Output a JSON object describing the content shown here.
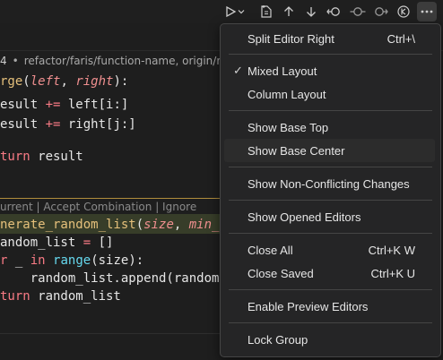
{
  "toolbar": {
    "icons": [
      "run-icon",
      "chevron-down-icon",
      "new-file-icon",
      "arrow-up-icon",
      "arrow-down-icon",
      "accept-current-icon",
      "accept-both-icon",
      "accept-incoming-icon",
      "toggle-icon",
      "more-icon"
    ]
  },
  "breadcrumb": {
    "num": "4",
    "dot": "•",
    "text": "refactor/faris/function-name, origin/refactor"
  },
  "code": {
    "l1_fn": "rge",
    "l1_open": "(",
    "l1_p1": "left",
    "l1_comma": ", ",
    "l2_var": "esult",
    "l2_op": " += ",
    "l2_rest": "left[i:]",
    "l3_var": "esult",
    "l3_op": " += ",
    "l3_rest": "right[j:]",
    "l4_kw": "turn",
    "l4_rest": " result",
    "conflict_actions": "urrent | Accept Combination | Ignore",
    "l5_fn": "nerate_random_list",
    "l5_open": "(",
    "l5_p1": "size",
    "l5_comma": ", ",
    "l5_p2": "min_",
    "l6_var": "andom_list",
    "l6_op": " = ",
    "l6_rest": "[]",
    "l7_kw": "r",
    "l7_mid": " _ ",
    "l7_in": "in",
    "l7_sp": " ",
    "l7_builtin": "range",
    "l7_rest": "(size):",
    "l8_text": "    random_list.append(random.r",
    "l9_kw": "turn",
    "l9_rest": " random_list"
  },
  "code_l1_p2": "right",
  "code_l1_close": "):",
  "menu": {
    "split_editor_right": "Split Editor Right",
    "split_editor_right_kb": "Ctrl+\\",
    "mixed_layout_check": "✓",
    "mixed_layout": "Mixed Layout",
    "column_layout": "Column Layout",
    "show_base_top": "Show Base Top",
    "show_base_center": "Show Base Center",
    "show_non_conflicting": "Show Non-Conflicting Changes",
    "show_opened_editors": "Show Opened Editors",
    "close_all": "Close All",
    "close_all_kb": "Ctrl+K W",
    "close_saved": "Close Saved",
    "close_saved_kb": "Ctrl+K U",
    "enable_preview": "Enable Preview Editors",
    "lock_group": "Lock Group"
  }
}
